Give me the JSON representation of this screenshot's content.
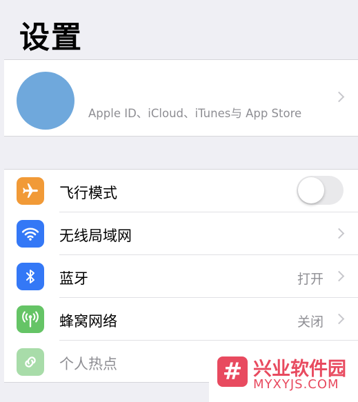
{
  "header": {
    "title": "设置"
  },
  "profile": {
    "subtitle": "Apple ID、iCloud、iTunes与 App Store"
  },
  "settings": {
    "airplane": {
      "label": "飞行模式",
      "icon": "airplane-icon",
      "color": "#f19a37",
      "toggle_on": false
    },
    "wifi": {
      "label": "无线局域网",
      "icon": "wifi-icon",
      "color": "#3478f6"
    },
    "bluetooth": {
      "label": "蓝牙",
      "icon": "bluetooth-icon",
      "color": "#3478f6",
      "value": "打开"
    },
    "cellular": {
      "label": "蜂窝网络",
      "icon": "antenna-icon",
      "color": "#65c466",
      "value": "关闭"
    },
    "hotspot": {
      "label": "个人热点",
      "icon": "link-icon",
      "color": "#a8dca9"
    }
  },
  "watermark": {
    "cn": "兴业软件园",
    "en": "MYXYJS.COM"
  }
}
